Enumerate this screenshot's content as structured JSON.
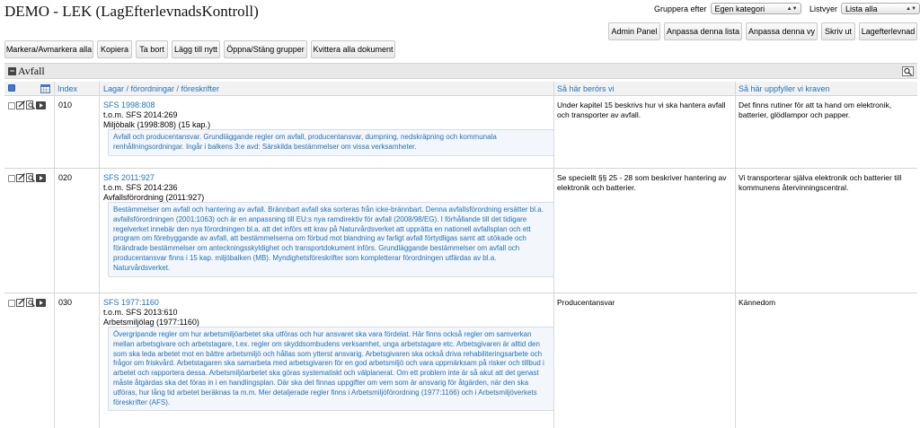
{
  "title": "DEMO - LEK (LagEfterlevnadsKontroll)",
  "group_by": {
    "label": "Gruppera efter",
    "value": "Egen kategori"
  },
  "list_view": {
    "label": "Listvyer",
    "value": "Lista alla"
  },
  "top_buttons": {
    "admin_panel": "Admin Panel",
    "customize_list": "Anpassa denna lista",
    "customize_view": "Anpassa denna vy",
    "print": "Skriv ut",
    "compliance": "Lagefterlevnad"
  },
  "toolbar": {
    "mark_all": "Markera/Avmarkera alla",
    "copy": "Kopiera",
    "remove": "Ta bort",
    "add_new": "Lägg till nytt",
    "toggle_groups": "Öppna/Stäng grupper",
    "ack_all": "Kvittera alla dokument"
  },
  "section": {
    "title": "Avfall"
  },
  "columns": {
    "index": "Index",
    "laws": "Lagar / förordningar / föreskrifter",
    "affected": "Så här berörs vi",
    "fulfill": "Så här uppfyller vi kraven"
  },
  "rows": [
    {
      "index": "010",
      "sfs": "SFS 1998:808",
      "tom": "t.o.m. SFS 2014:269",
      "name": "Miljöbalk (1998:808) (15 kap.)",
      "desc": "Avfall och producentansvar. Grundläggande regler om avfall, producentansvar, dumpning, nedskräpning och kommunala renhållningsordningar. Ingår i balkens 3:e avd: Särskilda bestämmelser om vissa verksamheter.",
      "affected": "Under kapitel 15 beskrivs hur vi ska hantera avfall och transporter av avfall.",
      "fulfill": "Det finns rutiner för att ta hand om elektronik, batterier, glödlampor och papper."
    },
    {
      "index": "020",
      "sfs": "SFS 2011:927",
      "tom": "t.o.m. SFS 2014:236",
      "name": "Avfallsförordning (2011:927)",
      "desc": "Bestämmelser om avfall och hantering av avfall. Brännbart avfall ska sorteras från icke-brännbart. Denna avfallsförordning ersätter bl.a. avfallsförordningen (2001:1063) och är en anpassning till EU:s nya ramdirektiv för avfall (2008/98/EG). I förhållande till det tidigare regelverket innebär den nya förordningen bl.a. att det införs ett krav på Naturvårdsverket att upprätta en nationell avfallsplan och ett program om förebyggande av avfall, att bestämmelserna om förbud mot blandning av farligt avfall förtydligas samt att utökade och förändrade bestämmelser om anteckningsskyldighet och transportdokument införs. Grundläggande bestämmelser om avfall och producentansvar finns i 15 kap. miljöbalken (MB). Myndighetsföreskrifter som kompletterar förordningen utfärdas av bl.a. Naturvårdsverket.",
      "affected": "Se speciellt §§ 25 - 28 som beskriver hantering av elektronik och batterier.",
      "fulfill": "Vi transporterar själva elektronik och batterier till kommunens återvinningscentral."
    },
    {
      "index": "030",
      "sfs": "SFS 1977:1160",
      "tom": "t.o.m. SFS 2013:610",
      "name": "Arbetsmiljölag (1977:1160)",
      "desc": "Övergripande regler om hur arbetsmiljöarbetet ska utföras och hur ansvaret ska vara fördelat. Här finns också regler om samverkan mellan arbetsgivare och arbetstagare, t.ex. regler om skyddsombudens verksamhet, unga arbetstagare etc. Arbetsgivaren är alltid den som ska leda arbetet mot en bättre arbetsmiljö och hållas som ytterst ansvarig. Arbetsgivaren ska också driva rehabiliteringsarbete och frågor om friskvård. Arbetstagaren ska samarbeta med arbetsgivaren för en god arbetsmiljö och vara uppmärksam på risker och tillbud i arbetet och rapportera dessa. Arbetsmiljöarbetet ska göras systematiskt och välplanerat. Om ett problem inte är så akut att det genast måste åtgärdas ska det föras in i en handlingsplan. Där ska det finnas uppgifter om vem som är ansvarig för åtgärden, när den ska utföras, hur lång tid arbetet beräknas ta m.m. Mer detaljerade regler finns i Arbetsmiljöförordning (1977:1166) och i Arbetsmiljöverkets föreskrifter (AFS).",
      "affected": "Producentansvar",
      "fulfill": "Kännedom"
    }
  ]
}
